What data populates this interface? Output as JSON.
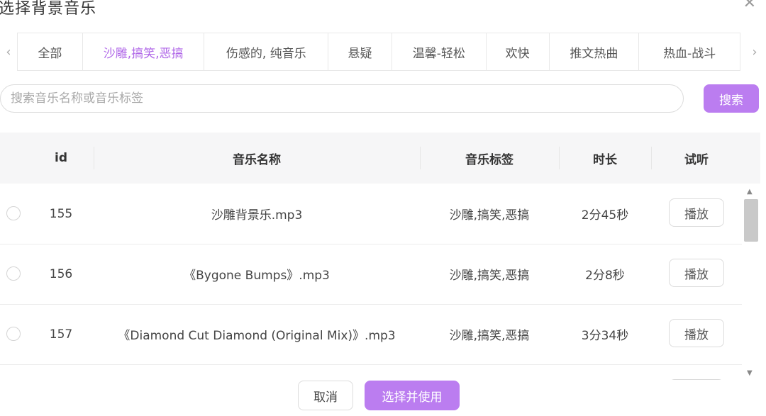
{
  "dialog": {
    "title": "选择背景音乐",
    "close_icon": "✕"
  },
  "tabs": {
    "prev_icon": "‹",
    "next_icon": "›",
    "items": [
      {
        "label": "全部"
      },
      {
        "label": "沙雕,搞笑,恶搞",
        "active": true
      },
      {
        "label": "伤感的, 纯音乐"
      },
      {
        "label": "悬疑"
      },
      {
        "label": "温馨-轻松"
      },
      {
        "label": "欢快"
      },
      {
        "label": "推文热曲"
      },
      {
        "label": "热血-战斗"
      }
    ]
  },
  "search": {
    "placeholder": "搜索音乐名称或音乐标签",
    "value": "",
    "button_label": "搜索"
  },
  "table": {
    "headers": {
      "id": "id",
      "name": "音乐名称",
      "tag": "音乐标签",
      "duration": "时长",
      "preview": "试听"
    },
    "rows": [
      {
        "id": "155",
        "name": "沙雕背景乐.mp3",
        "tag": "沙雕,搞笑,恶搞",
        "duration": "2分45秒",
        "play_label": "播放"
      },
      {
        "id": "156",
        "name": "《Bygone Bumps》.mp3",
        "tag": "沙雕,搞笑,恶搞",
        "duration": "2分8秒",
        "play_label": "播放"
      },
      {
        "id": "157",
        "name": "《Diamond Cut Diamond (Original Mix)》.mp3",
        "tag": "沙雕,搞笑,恶搞",
        "duration": "3分34秒",
        "play_label": "播放"
      }
    ]
  },
  "scrollbar": {
    "up_icon": "▲",
    "down_icon": "▼"
  },
  "footer": {
    "cancel_label": "取消",
    "confirm_label": "选择并使用"
  },
  "colors": {
    "accent": "#bb7df0",
    "active_tab": "#b067e8"
  }
}
